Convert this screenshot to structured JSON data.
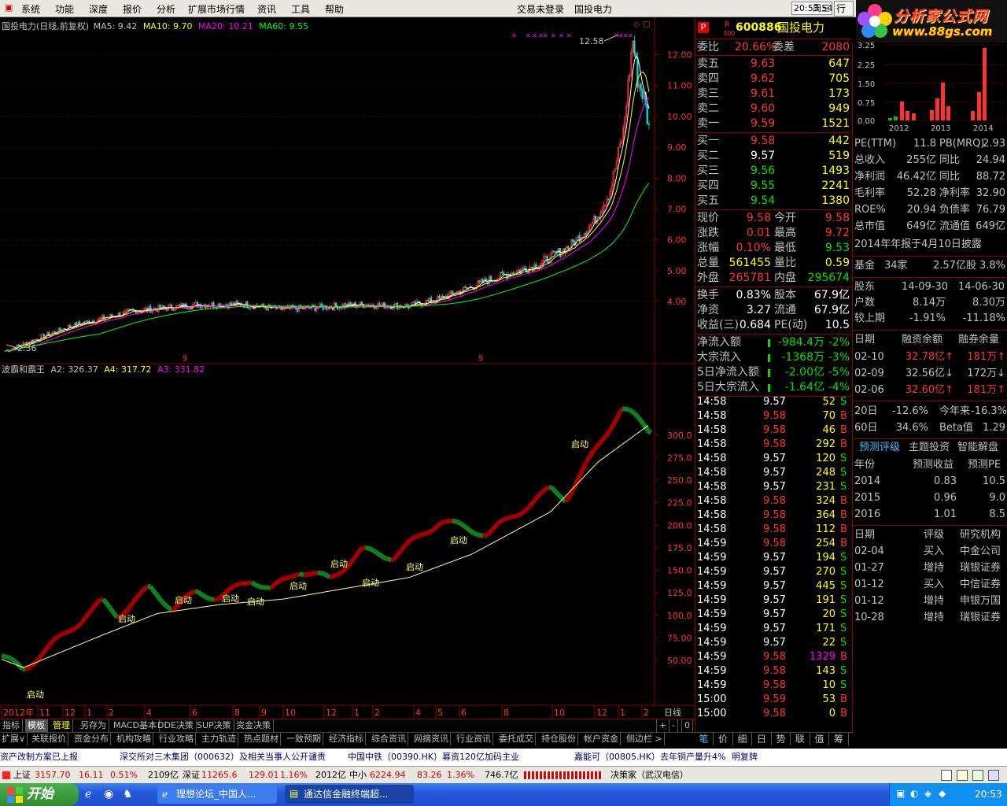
{
  "menubar": {
    "items": [
      "系统",
      "功能",
      "深度",
      "报价",
      "分析",
      "扩展市场行情",
      "资讯",
      "工具",
      "帮助"
    ],
    "status": "交易未登录",
    "stock_name": "国投电力",
    "time": "20:53:54",
    "weekday": "周三",
    "hang": "行"
  },
  "logo": {
    "text1": "分析家公式网",
    "text2": "www.88gs.com"
  },
  "main_chart": {
    "title": "国投电力(日线,前复权)",
    "ma5": "MA5: 9.42",
    "ma10": "MA10: 9.70",
    "ma20": "MA20: 10.21",
    "ma60": "MA60: 9.55",
    "high_label": "12.58",
    "low_label": "2.36",
    "y_ticks": [
      "12.00",
      "11.00",
      "10.00",
      "9.00",
      "8.00",
      "7.00",
      "6.00",
      "5.00",
      "4.00"
    ]
  },
  "sub_chart": {
    "title": "波霸和霸王",
    "a2": "A2: 326.37",
    "a4": "A4: 317.72",
    "a3": "A3: 331.82",
    "y_ticks": [
      "300.0",
      "275.0",
      "250.0",
      "225.0",
      "200.0",
      "175.0",
      "150.0",
      "125.0",
      "100.0",
      "75.00",
      "50.00"
    ],
    "signal_label": "启动"
  },
  "date_axis": {
    "labels": [
      "2012年",
      "11",
      "12",
      "1",
      "2",
      "4",
      "6",
      "8",
      "9",
      "10",
      "12",
      "1",
      "2",
      "4",
      "5",
      "6",
      "8",
      "10",
      "12",
      "1",
      "2"
    ],
    "period": "日线"
  },
  "colors": {
    "up": "#ff3232",
    "down": "#00e000",
    "ma5": "#ffffff",
    "ma10": "#ffff00",
    "ma20": "#ff00ff",
    "ma60": "#00ff00",
    "sub_a3": "#ffff80",
    "border": "#8b0000"
  },
  "quote": {
    "badge": "P",
    "tag": "R",
    "tag2": "300",
    "code": "600886",
    "name": "国投电力",
    "weibi_label": "委比",
    "weibi": "20.66%",
    "weicha_label": "委差",
    "weicha": "2080",
    "sells": [
      {
        "l": "卖五",
        "p": "9.63",
        "v": "647"
      },
      {
        "l": "卖四",
        "p": "9.62",
        "v": "705"
      },
      {
        "l": "卖三",
        "p": "9.61",
        "v": "173"
      },
      {
        "l": "卖二",
        "p": "9.60",
        "v": "949"
      },
      {
        "l": "卖一",
        "p": "9.59",
        "v": "1521"
      }
    ],
    "buys": [
      {
        "l": "买一",
        "p": "9.58",
        "v": "442"
      },
      {
        "l": "买二",
        "p": "9.57",
        "v": "519"
      },
      {
        "l": "买三",
        "p": "9.56",
        "v": "1493"
      },
      {
        "l": "买四",
        "p": "9.55",
        "v": "2241"
      },
      {
        "l": "买五",
        "p": "9.54",
        "v": "1380"
      }
    ],
    "stats": [
      {
        "l1": "现价",
        "v1": "9.58",
        "l2": "今开",
        "v2": "9.58"
      },
      {
        "l1": "涨跌",
        "v1": "0.01",
        "l2": "最高",
        "v2": "9.72"
      },
      {
        "l1": "涨幅",
        "v1": "0.10%",
        "l2": "最低",
        "v2": "9.53"
      },
      {
        "l1": "总量",
        "v1": "561455",
        "l2": "量比",
        "v2": "0.59"
      },
      {
        "l1": "外盘",
        "v1": "265781",
        "l2": "内盘",
        "v2": "295674"
      }
    ],
    "stats2": [
      {
        "l1": "换手",
        "v1": "0.83%",
        "l2": "股本",
        "v2": "67.9亿"
      },
      {
        "l1": "净资",
        "v1": "3.27",
        "l2": "流通",
        "v2": "67.9亿"
      },
      {
        "l1": "收益(三)",
        "v1": "0.684",
        "l2": "PE(动)",
        "v2": "10.5"
      }
    ],
    "flows": [
      {
        "l": "净流入额",
        "v": "-984.4万",
        "p": "-2%"
      },
      {
        "l": "大宗流入",
        "v": "-1368万",
        "p": "-3%"
      },
      {
        "l": "5日净流入额",
        "v": "-2.00亿",
        "p": "-5%"
      },
      {
        "l": "5日大宗流入",
        "v": "-1.64亿",
        "p": "-4%"
      }
    ],
    "ticks": [
      {
        "t": "14:58",
        "p": "9.57",
        "v": "52",
        "s": "S"
      },
      {
        "t": "14:58",
        "p": "9.58",
        "v": "70",
        "s": "B"
      },
      {
        "t": "14:58",
        "p": "9.58",
        "v": "46",
        "s": "B"
      },
      {
        "t": "14:58",
        "p": "9.58",
        "v": "292",
        "s": "B"
      },
      {
        "t": "14:58",
        "p": "9.57",
        "v": "120",
        "s": "S"
      },
      {
        "t": "14:58",
        "p": "9.57",
        "v": "248",
        "s": "S"
      },
      {
        "t": "14:58",
        "p": "9.57",
        "v": "231",
        "s": "S"
      },
      {
        "t": "14:58",
        "p": "9.58",
        "v": "324",
        "s": "B"
      },
      {
        "t": "14:58",
        "p": "9.58",
        "v": "364",
        "s": "B"
      },
      {
        "t": "14:58",
        "p": "9.58",
        "v": "112",
        "s": "B"
      },
      {
        "t": "14:59",
        "p": "9.58",
        "v": "254",
        "s": "B"
      },
      {
        "t": "14:59",
        "p": "9.57",
        "v": "194",
        "s": "S"
      },
      {
        "t": "14:59",
        "p": "9.57",
        "v": "270",
        "s": "S"
      },
      {
        "t": "14:59",
        "p": "9.57",
        "v": "445",
        "s": "S"
      },
      {
        "t": "14:59",
        "p": "9.57",
        "v": "191",
        "s": "S"
      },
      {
        "t": "14:59",
        "p": "9.57",
        "v": "20",
        "s": "S"
      },
      {
        "t": "14:59",
        "p": "9.57",
        "v": "171",
        "s": "S"
      },
      {
        "t": "14:59",
        "p": "9.57",
        "v": "22",
        "s": "S"
      },
      {
        "t": "14:59",
        "p": "9.58",
        "v": "1329",
        "s": "B"
      },
      {
        "t": "14:59",
        "p": "9.58",
        "v": "143",
        "s": "S"
      },
      {
        "t": "14:59",
        "p": "9.58",
        "v": "10",
        "s": "S"
      },
      {
        "t": "15:00",
        "p": "9.59",
        "v": "53",
        "s": "B"
      },
      {
        "t": "15:00",
        "p": "9.58",
        "v": "0",
        "s": "B"
      }
    ]
  },
  "fundamentals": {
    "eps_chart": {
      "y_ticks": [
        "3.25",
        "2.50",
        "2.25",
        "1.50",
        "0.75",
        "0.00"
      ],
      "x_labels": [
        "2012",
        "2013",
        "2014"
      ]
    },
    "rows1": [
      {
        "l1": "PE(TTM)",
        "v1": "11.8",
        "l2": "PB(MRQ)",
        "v2": "2.93"
      },
      {
        "l1": "总收入",
        "v1": "255亿",
        "l2": "同比",
        "v2": "24.94"
      },
      {
        "l1": "净利润",
        "v1": "46.42亿",
        "l2": "同比",
        "v2": "88.72"
      },
      {
        "l1": "毛利率",
        "v1": "52.28",
        "l2": "净利率",
        "v2": "32.90"
      },
      {
        "l1": "ROE%",
        "v1": "20.94",
        "l2": "负债率",
        "v2": "76.79"
      },
      {
        "l1": "总市值",
        "v1": "649亿",
        "l2": "流通值",
        "v2": "649亿"
      }
    ],
    "report": "2014年年报于4月10日披露",
    "fund": {
      "l": "基金",
      "a": "34家",
      "b": "2.57亿股",
      "c": "3.8%"
    },
    "holders": {
      "l": "股东",
      "d1": "14-09-30",
      "d2": "14-06-30",
      "r1l": "户数",
      "r1a": "8.14万",
      "r1b": "8.30万",
      "r2l": "较上期",
      "r2a": "-1.91%",
      "r2b": "-11.18%"
    },
    "margin": {
      "h1": "日期",
      "h2": "融资余额",
      "h3": "融券余量",
      "rows": [
        {
          "d": "02-10",
          "a": "32.78亿↑",
          "b": "181万↑"
        },
        {
          "d": "02-09",
          "a": "32.56亿↓",
          "b": "172万↓"
        },
        {
          "d": "02-06",
          "a": "32.60亿↑",
          "b": "181万↑"
        }
      ]
    },
    "perf": [
      {
        "l1": "20日",
        "v1": "-12.6%",
        "l2": "今年来",
        "v2": "-16.3%"
      },
      {
        "l1": "60日",
        "v1": "34.6%",
        "l2": "Beta值",
        "v2": "1.29"
      }
    ],
    "tabs": [
      "预测评级",
      "主题投资",
      "智能解盘"
    ],
    "forecast": {
      "h": [
        "年份",
        "预测收益",
        "预测PE"
      ],
      "rows": [
        [
          "2014",
          "0.83",
          "10.5"
        ],
        [
          "2015",
          "0.96",
          "9.0"
        ],
        [
          "2016",
          "1.01",
          "8.5"
        ]
      ]
    },
    "ratings": {
      "h": [
        "日期",
        "评级",
        "研究机构"
      ],
      "rows": [
        [
          "02-04",
          "买入",
          "中金公司"
        ],
        [
          "01-27",
          "增持",
          "瑞银证券"
        ],
        [
          "01-12",
          "买入",
          "中信证券"
        ],
        [
          "01-12",
          "增持",
          "申银万国"
        ],
        [
          "10-28",
          "增持",
          "瑞银证券"
        ]
      ]
    }
  },
  "tabs1": [
    "指标",
    "模板",
    "管理",
    "另存为",
    "MACD基本",
    "DDE决策",
    "SUP决策",
    "资金决策"
  ],
  "tabs1_ctrl": [
    "+",
    "-",
    "0"
  ],
  "tabs2": [
    "扩展∨",
    "关联报价",
    "资金分布",
    "机构攻略",
    "行业攻略",
    "主力轨迹",
    "热点题材",
    "一致预期",
    "经济指标",
    "综合资讯",
    "网摘资讯",
    "行业资讯",
    "委托成交",
    "持仓股份",
    "帐户资金",
    "侧边栏 >"
  ],
  "rtabs": [
    "笔",
    "价",
    "细",
    "日",
    "势",
    "联",
    "值",
    "筹"
  ],
  "news": [
    "资产改制方案已上报",
    "深交所对三木集团（000632）及相关当事人公开谴责",
    "中国中铁（00390.HK）募资120亿加码主业",
    "嘉能可（00805.HK）去年铜产量升4%",
    "明复牌"
  ],
  "indexbar": {
    "sh_label": "上证",
    "sh": "3157.70",
    "sh_chg": "16.11",
    "sh_pct": "0.51%",
    "sh_amt": "2109亿",
    "sz_label": "深证",
    "sz": "11265.6",
    "sz_chg": "129.01",
    "sz_pct": "1.16%",
    "sz_amt": "2012亿",
    "zx_label": "中小",
    "zx": "6224.94",
    "zx_chg": "83.26",
    "zx_pct": "1.36%",
    "zx_amt": "746.7亿",
    "broker": "决策家（武汉电信）"
  },
  "taskbar": {
    "start": "开始",
    "tasks": [
      "理想论坛_中国人...",
      "通达信金融终端超..."
    ],
    "clock": "20:53"
  }
}
